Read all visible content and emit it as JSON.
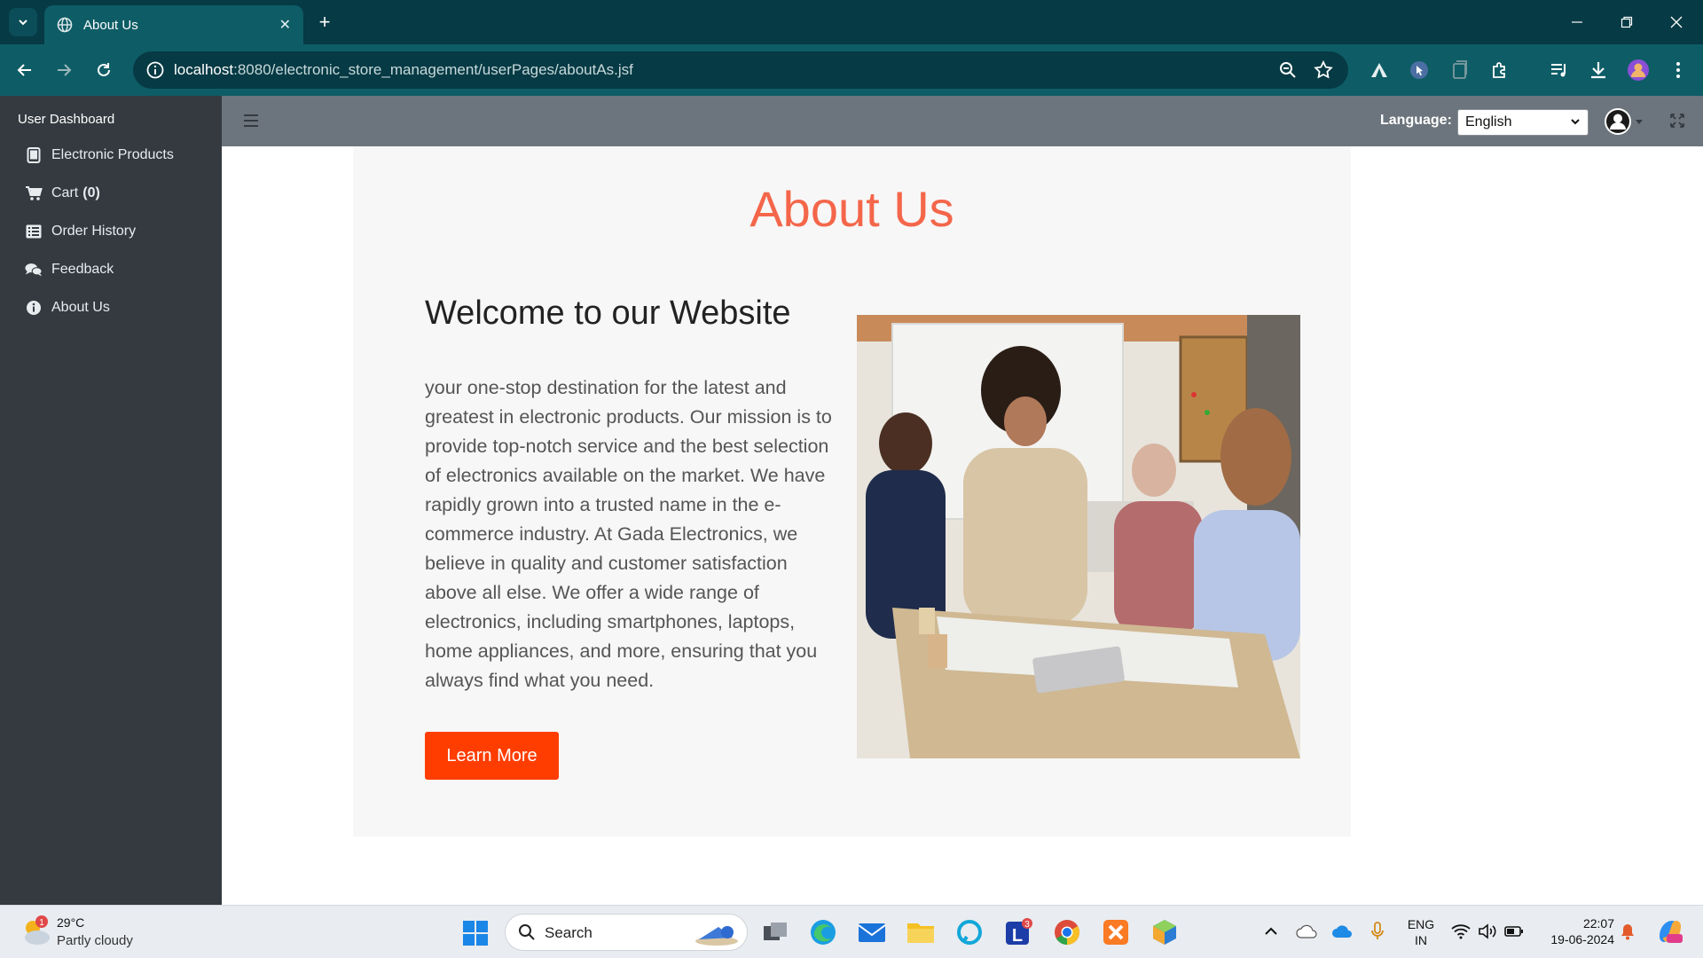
{
  "browser": {
    "tab_title": "About Us",
    "url_host": "localhost",
    "url_rest": ":8080/electronic_store_management/userPages/aboutAs.jsf"
  },
  "sidebar": {
    "brand": "User Dashboard",
    "items": [
      {
        "label": "Electronic Products",
        "icon": "tablet-icon"
      },
      {
        "label": "Cart",
        "badge": "(0)",
        "icon": "cart-icon"
      },
      {
        "label": "Order History",
        "icon": "list-icon"
      },
      {
        "label": "Feedback",
        "icon": "comments-icon"
      },
      {
        "label": "About Us",
        "icon": "info-icon"
      }
    ]
  },
  "header": {
    "language_label": "Language:",
    "language_value": "English"
  },
  "main": {
    "title": "About Us",
    "welcome": "Welcome to our Website",
    "paragraph": "your one-stop destination for the latest and greatest in electronic products. Our mission is to provide top-notch service and the best selection of electronics available on the market. We have rapidly grown into a trusted name in the e-commerce industry. At Gada Electronics, we believe in quality and customer satisfaction above all else. We offer a wide range of electronics, including smartphones, laptops, home appliances, and more, ensuring that you always find what you need.",
    "button_label": "Learn More"
  },
  "taskbar": {
    "weather_temp": "29°C",
    "weather_desc": "Partly cloudy",
    "weather_badge": "1",
    "search_label": "Search",
    "app_badge": "3",
    "lang_line1": "ENG",
    "lang_line2": "IN",
    "time": "22:07",
    "date": "19-06-2024"
  },
  "colors": {
    "title_accent": "#f4664a",
    "button": "#ff3d00",
    "sidebar_bg": "#343a40",
    "header_bg": "#6c757d",
    "browser_chrome": "#0e5d66"
  }
}
